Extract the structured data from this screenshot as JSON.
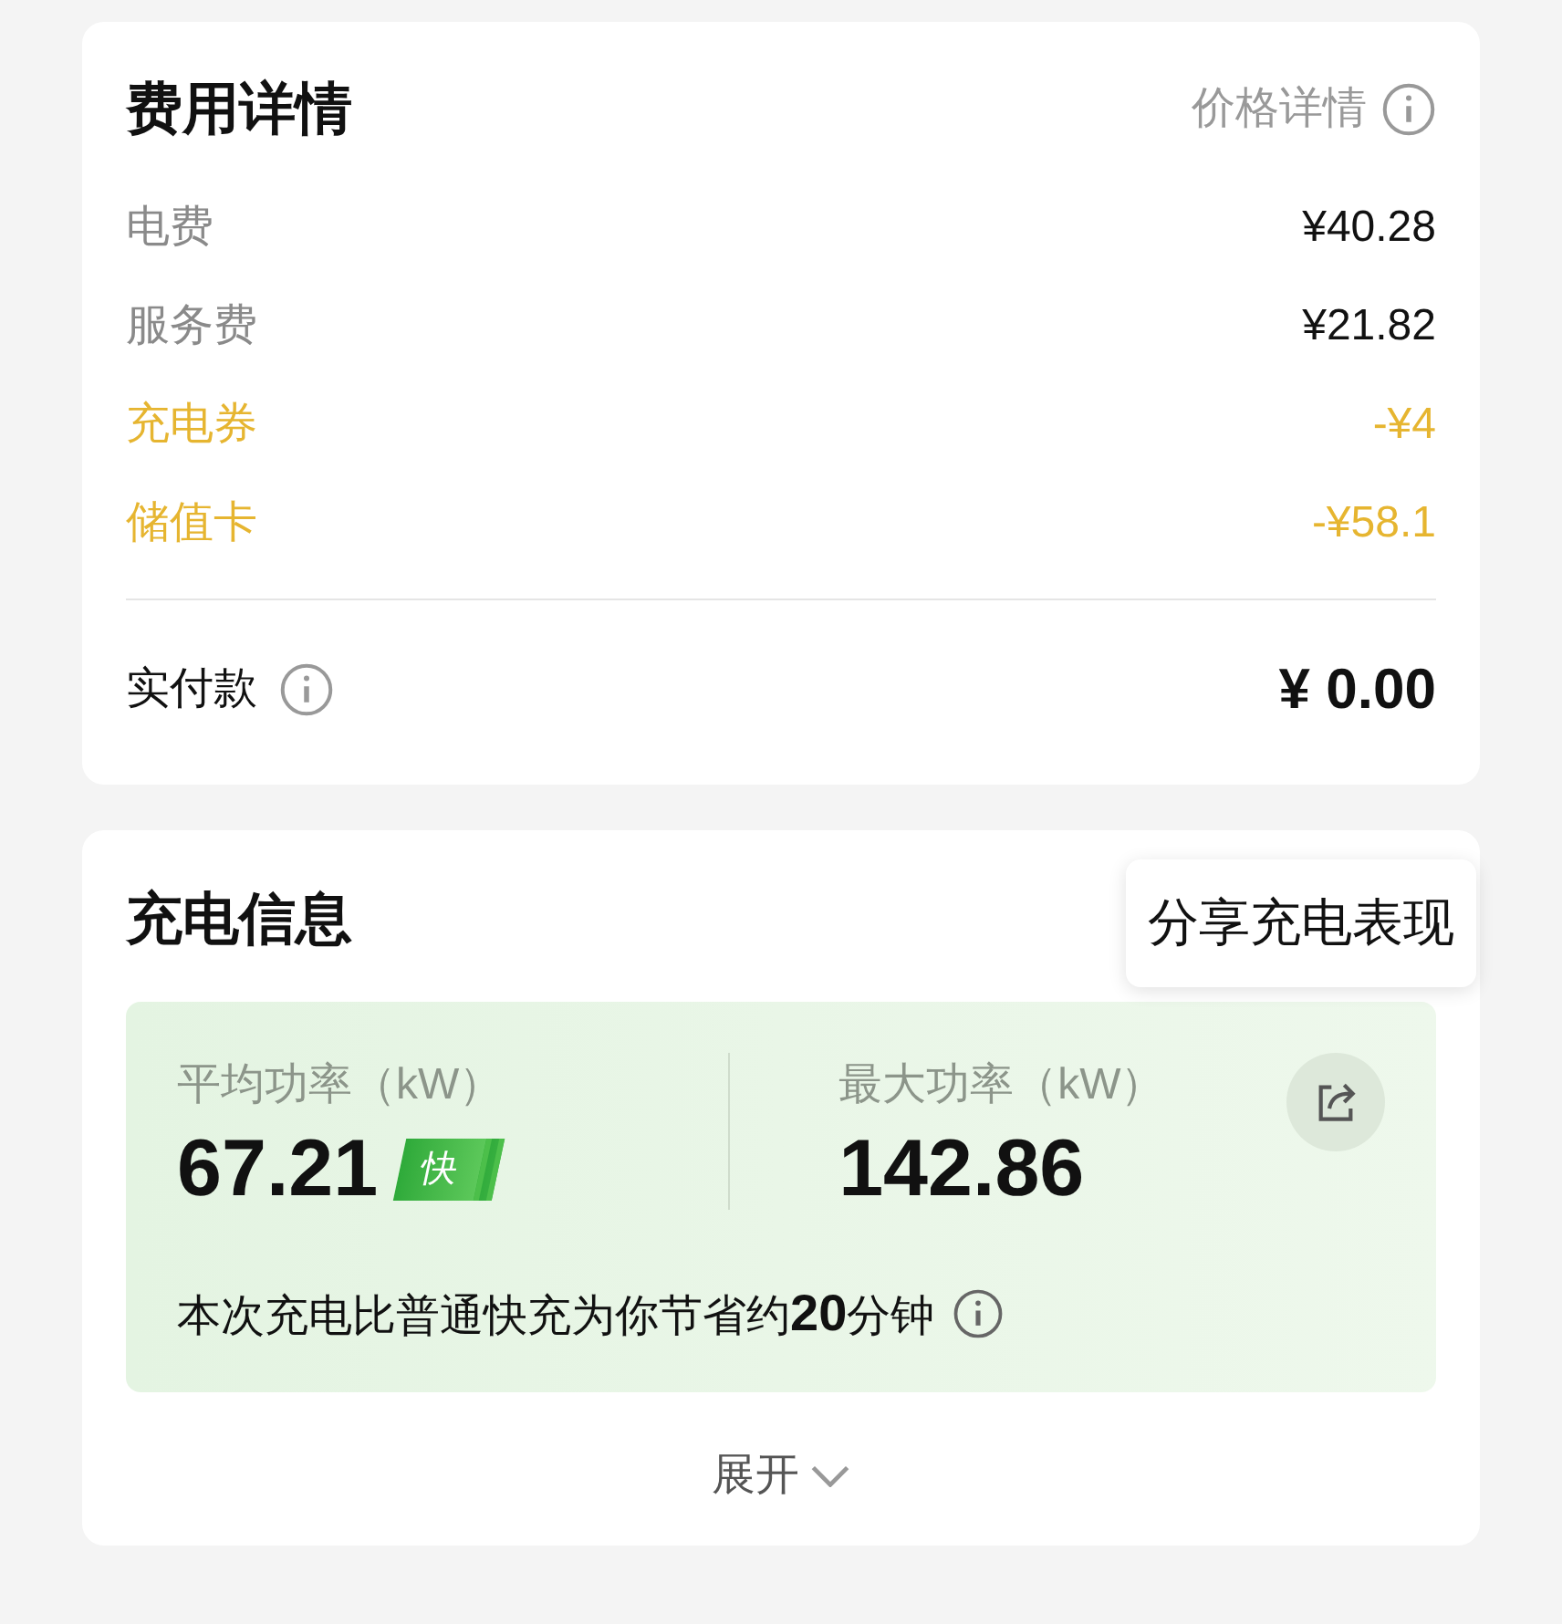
{
  "fee_card": {
    "title": "费用详情",
    "price_link": "价格详情",
    "rows": [
      {
        "label": "电费",
        "value": "¥40.28",
        "kind": "charge"
      },
      {
        "label": "服务费",
        "value": "¥21.82",
        "kind": "charge"
      },
      {
        "label": "充电券",
        "value": "-¥4",
        "kind": "discount"
      },
      {
        "label": "储值卡",
        "value": "-¥58.1",
        "kind": "discount"
      }
    ],
    "total_label": "实付款",
    "total_value": "¥ 0.00"
  },
  "charge_card": {
    "title": "充电信息",
    "tooltip": "分享充电表现",
    "stats": [
      {
        "label": "平均功率（kW）",
        "value": "67.21",
        "badge": "快"
      },
      {
        "label": "最大功率（kW）",
        "value": "142.86"
      }
    ],
    "note": "本次充电比普通快充为你节省约**20**分钟",
    "expand": "展开"
  }
}
